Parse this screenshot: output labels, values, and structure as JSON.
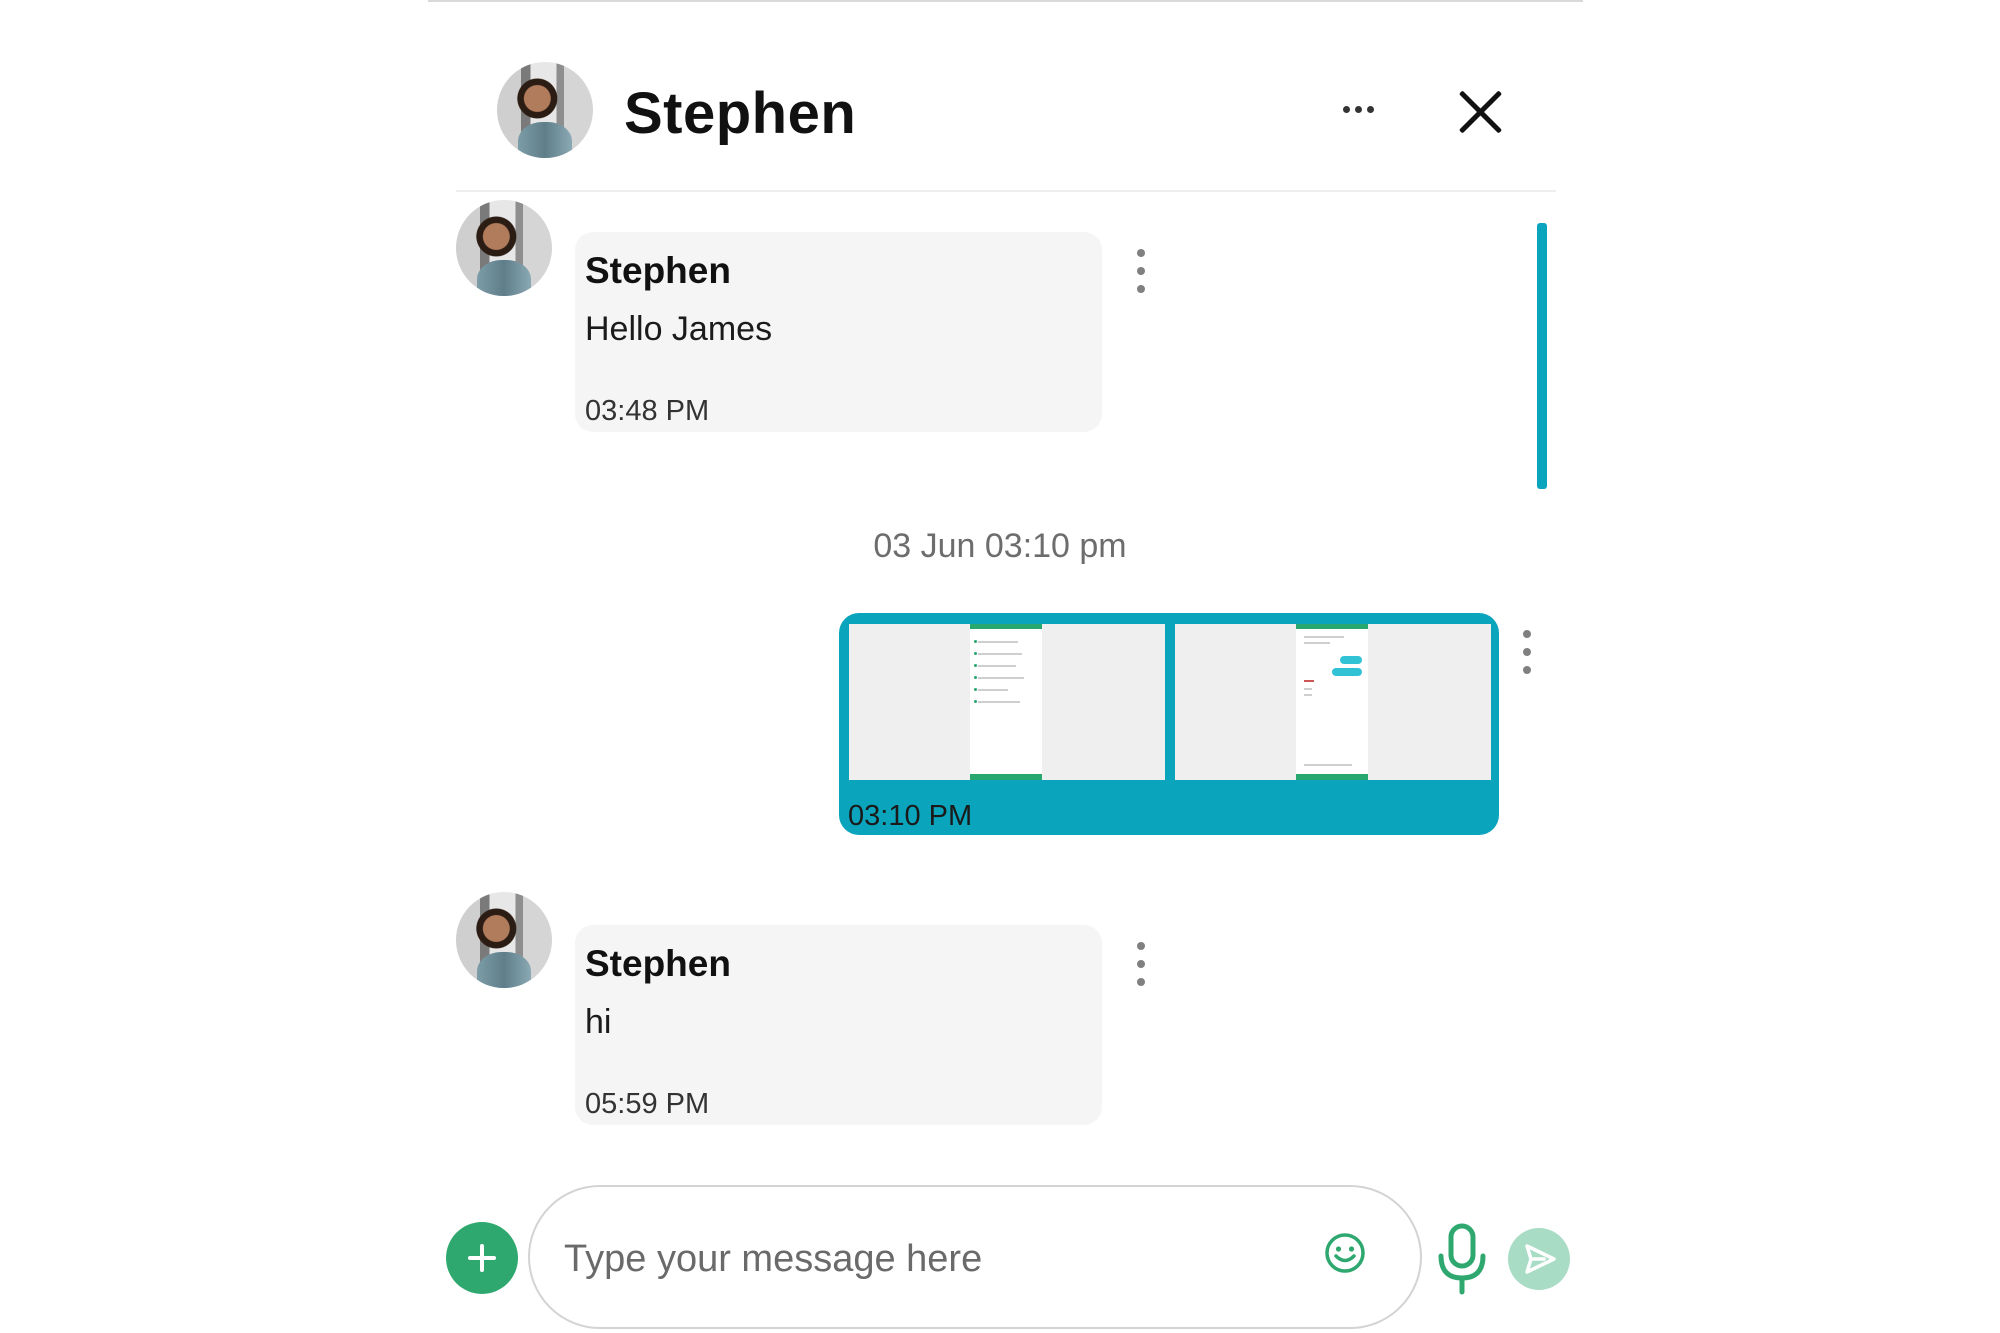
{
  "header": {
    "title": "Stephen",
    "more_icon": "ellipsis-horizontal-icon",
    "close_icon": "close-icon"
  },
  "messages": [
    {
      "sender": "Stephen",
      "text": "Hello James",
      "time": "03:48 PM",
      "direction": "incoming"
    },
    {
      "sender": "Stephen",
      "text": "hi",
      "time": "05:59 PM",
      "direction": "incoming"
    }
  ],
  "date_separator": "03 Jun 03:10 pm",
  "outgoing_image_message": {
    "time": "03:10 PM",
    "image_count": 2
  },
  "composer": {
    "placeholder": "Type your message here",
    "add_icon": "plus-icon",
    "emoji_icon": "smiley-icon",
    "mic_icon": "microphone-icon",
    "send_icon": "send-icon"
  },
  "colors": {
    "accent_teal": "#0aa5bd",
    "accent_green": "#2fa86f",
    "send_disabled": "#a8dcc4",
    "bubble_bg": "#f5f5f5"
  }
}
